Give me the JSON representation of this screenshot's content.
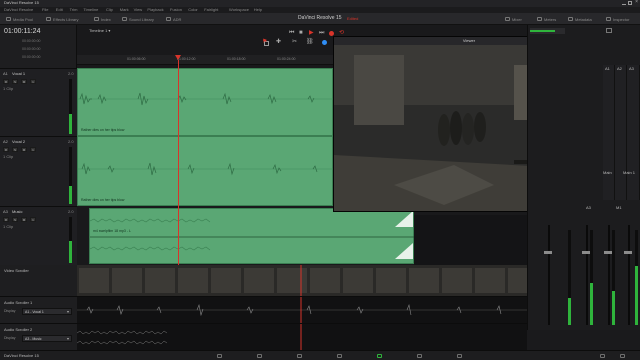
{
  "app": {
    "window_title": "DaVinci Resolve 15",
    "project_title": "DaVinci Resolve 15",
    "project_status": "Edited",
    "footer_brand": "DaVinci Resolve 15"
  },
  "menu": [
    "DaVinci Resolve",
    "File",
    "Edit",
    "Trim",
    "Timeline",
    "Clip",
    "Mark",
    "View",
    "Playback",
    "Fusion",
    "Color",
    "Fairlight",
    "Workspace",
    "Help"
  ],
  "toolbar": {
    "left": [
      "Media Pool",
      "Effects Library",
      "Index",
      "Sound Library",
      "ADR"
    ],
    "right": [
      "Mixer",
      "Meters",
      "Metadata",
      "Inspector"
    ]
  },
  "timecode": "01:00:11:24",
  "timeline_name": "Timeline 1",
  "ruler_ticks": [
    "01:00:00:00",
    "01:00:06:00",
    "01:00:12:00",
    "01:00:18:00",
    "01:00:24:00"
  ],
  "timecode_rows": [
    "00:00:00:00",
    "00:00:00:00",
    "00:00:00:00"
  ],
  "tracks": [
    {
      "id": "A1",
      "name": "Vocal 1",
      "gain": "2.0",
      "clips": "1 Clip",
      "clip_label": "Rather dies on her tips blow"
    },
    {
      "id": "A2",
      "name": "Vocal 2",
      "gain": "2.0",
      "clips": "1 Clip",
      "clip_label": "Rather dies on her tips blow"
    },
    {
      "id": "A3",
      "name": "Music",
      "gain": "2.0",
      "clips": "1 Clip",
      "clip_label": "m4 swelpfilm 18 mp3 - L"
    }
  ],
  "track_buttons": [
    "R",
    "S",
    "M",
    "1"
  ],
  "viewer": {
    "title": "Viewer"
  },
  "bottom": {
    "video_scroller": "Video Scroller",
    "scroller1": {
      "label": "Audio Scroller 1",
      "display_label": "Display",
      "value": "A1 - Vocal 1"
    },
    "scroller2": {
      "label": "Audio Scroller 2",
      "display_label": "Display",
      "value": "A3 - Music"
    }
  },
  "mixer": {
    "columns": [
      "A1",
      "A2",
      "A3",
      "Bus1"
    ],
    "labels": [
      "Main",
      "Main 1",
      "A3",
      "M1"
    ],
    "meter_levels": [
      0.28,
      0.44,
      0.36,
      0.62
    ]
  },
  "colors": {
    "clip": "#5aa774",
    "accent_blue": "#2f8df5",
    "record_red": "#d8342a",
    "meter_green": "#2fb43c"
  },
  "nav": [
    "media",
    "cut",
    "edit",
    "fusion",
    "color",
    "fairlight",
    "deliver",
    "home",
    "settings"
  ],
  "icons": [
    "search-icon",
    "zoom-icon",
    "flag-icon",
    "marker-icon",
    "scissors-icon",
    "lock-icon",
    "play-icon",
    "stop-icon",
    "record-icon",
    "loop-icon"
  ]
}
